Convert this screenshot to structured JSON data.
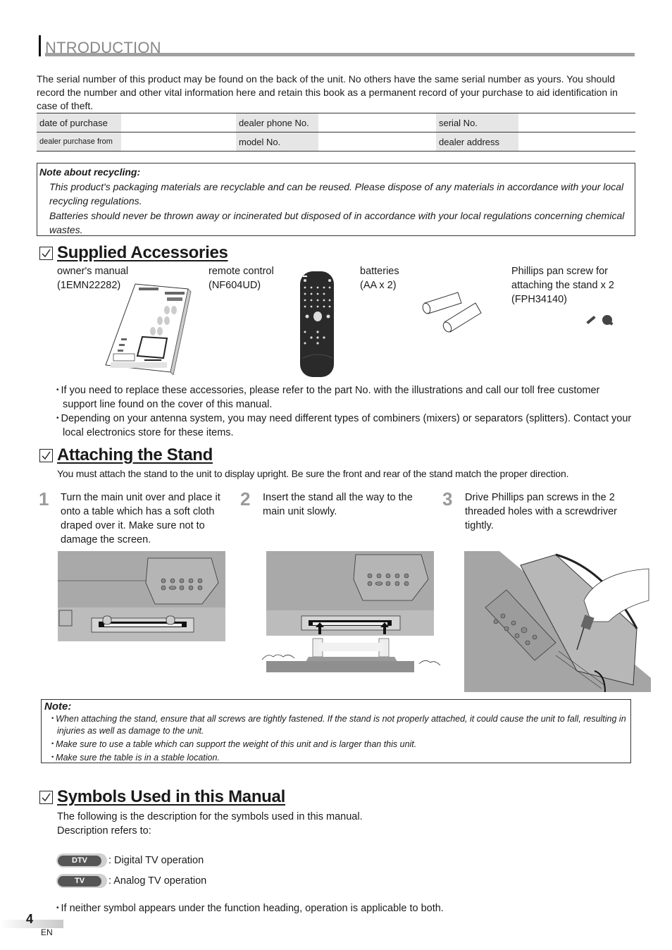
{
  "header": {
    "initial": "I",
    "title": "NTRODUCTION"
  },
  "intro_text": "The serial number of this product may be found on the back of the unit. No others have the same serial number as yours. You should record the number and other vital information here and retain this book as a permanent record of your purchase to aid identification in case of theft.",
  "record_table": {
    "rows": [
      [
        {
          "label": "date of purchase",
          "value": ""
        },
        {
          "label": "dealer phone No.",
          "value": ""
        },
        {
          "label": "serial No.",
          "value": ""
        }
      ],
      [
        {
          "label": "dealer purchase from",
          "value": ""
        },
        {
          "label": "model No.",
          "value": ""
        },
        {
          "label": "dealer address",
          "value": ""
        }
      ]
    ]
  },
  "recycling": {
    "title": "Note about recycling:",
    "paragraphs": [
      "This product's packaging materials are recyclable and can be reused. Please dispose of any materials in accordance with your local recycling regulations.",
      "Batteries should never be thrown away or incinerated but disposed of in accordance with your local regulations concerning chemical wastes."
    ]
  },
  "supplied_accessories": {
    "heading": "Supplied Accessories",
    "items": [
      {
        "name": "owner's manual",
        "part": "(1EMN22282)",
        "icon": "manual-icon"
      },
      {
        "name": "remote control",
        "part": "(NF604UD)",
        "icon": "remote-control-icon"
      },
      {
        "name": "batteries",
        "part": "(AA x 2)",
        "icon": "batteries-icon"
      },
      {
        "name": "Phillips pan screw for",
        "name2": "attaching the stand  x 2",
        "part": "(FPH34140)",
        "icon": "screws-icon"
      }
    ],
    "bullets": [
      "If you need to replace these accessories, please refer to the part No. with the illustrations and call our toll free customer support line found on the cover of this manual.",
      "Depending on your antenna system, you may need different types of combiners (mixers) or separators (splitters). Contact your local electronics store for these items."
    ]
  },
  "attaching_stand": {
    "heading": "Attaching the Stand",
    "intro": "You must attach the stand to the unit to display upright. Be sure the front and rear of the stand match the proper direction.",
    "steps": [
      {
        "num": "1",
        "text": "Turn the main unit over and place it onto a table which has a soft cloth draped over it. Make sure not to damage the screen."
      },
      {
        "num": "2",
        "text": "Insert the stand all the way to the main unit slowly."
      },
      {
        "num": "3",
        "text": "Drive Phillips pan screws in the 2 threaded holes with a screwdriver tightly."
      }
    ],
    "note": {
      "title": "Note:",
      "bullets": [
        "When attaching the stand, ensure that all screws are tightly fastened. If the stand is not properly attached, it could cause the unit to fall, resulting in injuries as well as damage to the unit.",
        "Make sure to use a table which can support the weight of this unit and is larger than this unit.",
        "Make sure the table is in a stable location."
      ]
    }
  },
  "symbols": {
    "heading": "Symbols Used in this Manual",
    "intro1": "The following is the description for the symbols used in this manual.",
    "intro2": "Description refers to:",
    "items": [
      {
        "badge": "DTV",
        "desc": ": Digital TV operation"
      },
      {
        "badge": "TV",
        "desc": ": Analog TV operation"
      }
    ],
    "bullet": "If neither symbol appears under the function heading, operation is applicable to both."
  },
  "footer": {
    "page": "4",
    "lang": "EN"
  }
}
